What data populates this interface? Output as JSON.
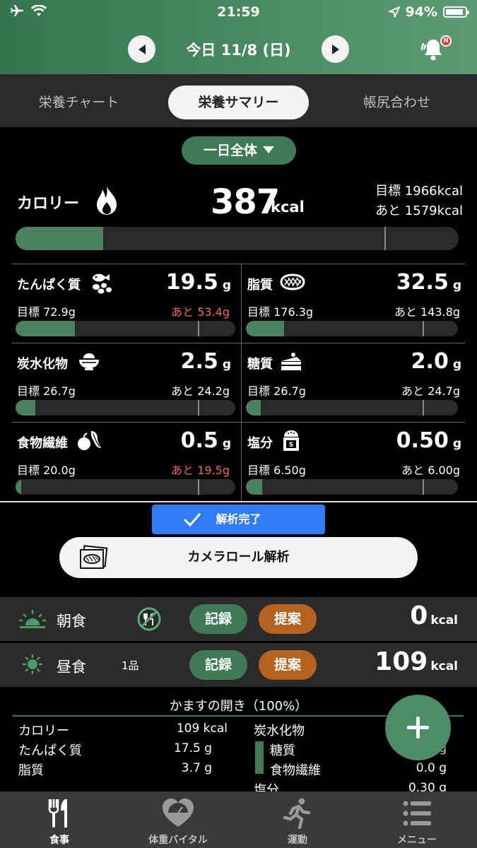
{
  "status": {
    "time": "21:59",
    "battery": "94%"
  },
  "header": {
    "date_title": "今日 11/8 (日)",
    "notification_badge": "N"
  },
  "tabs": [
    {
      "label": "栄養チャート",
      "active": false
    },
    {
      "label": "栄養サマリー",
      "active": true
    },
    {
      "label": "帳尻合わせ",
      "active": false
    }
  ],
  "scope_dropdown": "一日全体",
  "calorie": {
    "label": "カロリー",
    "value": "387",
    "unit": "kcal",
    "target": "目標 1966kcal",
    "remaining": "あと 1579kcal",
    "progress": 0.197
  },
  "nutrients": [
    {
      "name": "たんぱく質",
      "value": "19.5",
      "unit": "g",
      "target": "目標 72.9g",
      "remaining": "あと 53.4g",
      "over": true,
      "progress": 0.27,
      "icon": "fish-beans-icon"
    },
    {
      "name": "脂質",
      "value": "32.5",
      "unit": "g",
      "target": "目標 176.3g",
      "remaining": "あと 143.8g",
      "over": false,
      "progress": 0.18,
      "icon": "fat-icon"
    },
    {
      "name": "炭水化物",
      "value": "2.5",
      "unit": "g",
      "target": "目標 26.7g",
      "remaining": "あと 24.2g",
      "over": false,
      "progress": 0.09,
      "icon": "rice-bowl-icon"
    },
    {
      "name": "糖質",
      "value": "2.0",
      "unit": "g",
      "target": "目標 26.7g",
      "remaining": "あと 24.7g",
      "over": false,
      "progress": 0.07,
      "icon": "cake-icon"
    },
    {
      "name": "食物繊維",
      "value": "0.5",
      "unit": "g",
      "target": "目標 20.0g",
      "remaining": "あと 19.5g",
      "over": true,
      "progress": 0.025,
      "icon": "vegetable-icon"
    },
    {
      "name": "塩分",
      "value": "0.50",
      "unit": "g",
      "target": "目標 6.50g",
      "remaining": "あと 6.00g",
      "over": false,
      "progress": 0.077,
      "icon": "salt-icon"
    }
  ],
  "analysis_done_label": "解析完了",
  "camera_roll_label": "カメラロール解析",
  "meals": [
    {
      "name": "朝食",
      "count": "",
      "record": "記録",
      "suggest": "提案",
      "kcal": "0",
      "unit": "kcal",
      "icon": "sunrise-icon"
    },
    {
      "name": "昼食",
      "count": "1品",
      "record": "記録",
      "suggest": "提案",
      "kcal": "109",
      "unit": "kcal",
      "icon": "sun-icon"
    }
  ],
  "food": {
    "title": "かますの開き（100%）",
    "left": [
      {
        "label": "カロリー",
        "value": "109 kcal"
      },
      {
        "label": "たんぱく質",
        "value": "17.5 g"
      },
      {
        "label": "脂質",
        "value": "3.7 g"
      }
    ],
    "right": [
      {
        "label": "炭水化物",
        "value": ""
      },
      {
        "label": "糖質",
        "value": "g"
      },
      {
        "label": "食物繊維",
        "value": "0.0 g"
      },
      {
        "label": "塩分",
        "value": "0.30 g"
      }
    ]
  },
  "tabbar": [
    {
      "label": "食事",
      "icon": "fork-knife-icon",
      "active": true
    },
    {
      "label": "体重バイタル",
      "icon": "heart-scale-icon",
      "active": false
    },
    {
      "label": "運動",
      "icon": "running-icon",
      "active": false
    },
    {
      "label": "メニュー",
      "icon": "menu-list-icon",
      "active": false
    }
  ]
}
